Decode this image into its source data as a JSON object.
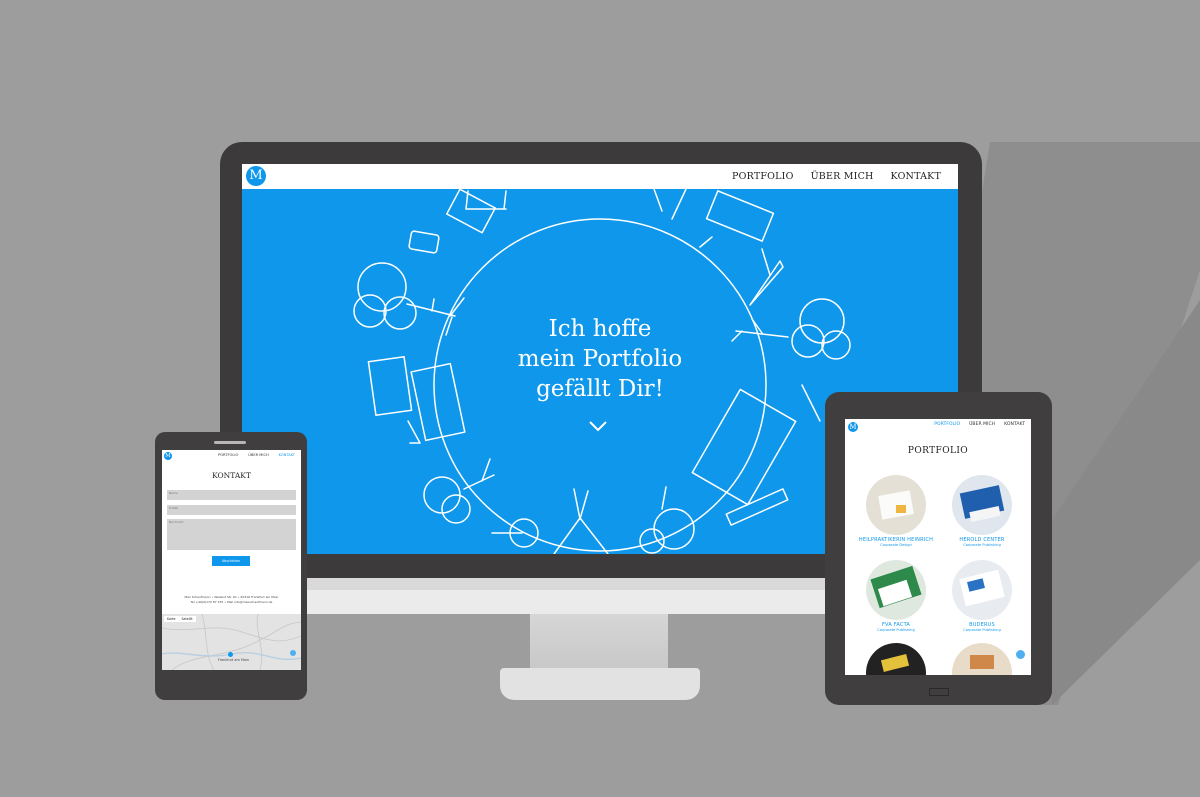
{
  "colors": {
    "background": "#9d9d9d",
    "accent": "#0e97eb",
    "device": "#3d3a3b"
  },
  "desktop": {
    "logo": "M",
    "nav": [
      "PORTFOLIO",
      "ÜBER MICH",
      "KONTAKT"
    ],
    "hero": {
      "line1": "Ich hoffe",
      "line2": "mein Portfolio",
      "line3": "gefällt Dir!"
    },
    "scroll_icon": "chevron-down-icon"
  },
  "tablet": {
    "logo": "M",
    "nav": [
      "PORTFOLIO",
      "ÜBER MICH",
      "KONTAKT"
    ],
    "active_nav": "PORTFOLIO",
    "title": "PORTFOLIO",
    "items": [
      {
        "name": "HEILPRAKTIKERIN HEINRICH",
        "sub": "Corporate Design"
      },
      {
        "name": "HEROLD CENTER",
        "sub": "Corporate Publishing"
      },
      {
        "name": "FVA FACTA",
        "sub": "Corporate Publishing"
      },
      {
        "name": "BUDERUS",
        "sub": "Corporate Publishing"
      }
    ]
  },
  "phone": {
    "logo": "M",
    "nav": [
      "PORTFOLIO",
      "ÜBER MICH",
      "KONTAKT"
    ],
    "active_nav": "KONTAKT",
    "title": "KONTAKT",
    "fields": {
      "name": "Name",
      "email": "E-Mail",
      "message": "Nachricht"
    },
    "submit": "Abschicken",
    "address": "Max Schaufmann • Weiland Str. 61 • 60316 Frankfurt am Main",
    "contact": "Tel +49(0)170 87 155 • Mail info@maxschaufmann.de",
    "map_tabs": [
      "Karte",
      "Satellit"
    ],
    "map_label": "Frankfurt am Main"
  }
}
